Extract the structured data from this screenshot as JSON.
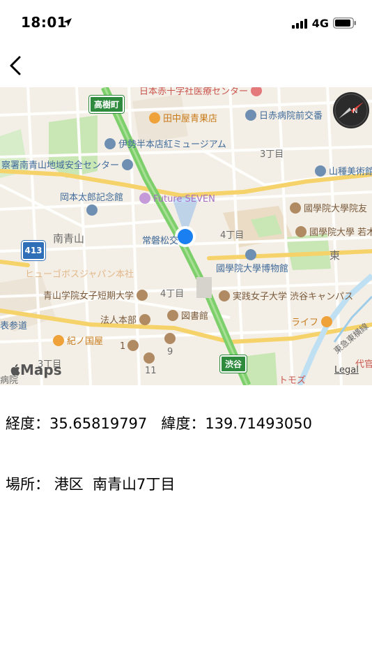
{
  "status_bar": {
    "time": "18:01",
    "network": "4G"
  },
  "nav": {
    "back_icon": "chevron-left-icon"
  },
  "map": {
    "labels": {
      "takagi": "高樹町",
      "red_cross_center": "日本赤十字社医療センター",
      "tanakaya": "田中屋青果店",
      "red_cross_hospital": "日赤病院前交番",
      "isehan": "伊勢半本店紅ミュージアム",
      "chome3": "3丁目",
      "police": "察署南青山地域安全センター",
      "yamatane": "山種美術館",
      "okamoto": "岡本太郎記念館",
      "future_seven": "Future SEVEN",
      "kokugakuin_tomo": "國學院大學院友",
      "minami_aoyama": "南青山",
      "tokiwamatsu": "常磐松交",
      "chome4a": "4丁目",
      "kokugakuin_waka": "國學院大學 若木",
      "route413": "413",
      "higashi": "東",
      "hugo": "ヒューゴボスジャパン本社",
      "kokugakuin_museum": "國學院大學博物館",
      "aoyama_women": "青山学院女子短期大学",
      "chome4b": "4丁目",
      "jissen": "実践女子大学 渋谷キャンパス",
      "houjin": "法人本部",
      "library": "図書館",
      "life": "ライフ",
      "omotesando": "表参道",
      "kinokuniya": "紀ノ国屋",
      "tokyu": "東急東横線",
      "num1": "1",
      "num9": "9",
      "shibuya": "渋谷",
      "chome3b": "3丁目",
      "num11": "11",
      "hospital": "病院",
      "tomoz": "トモズ",
      "daikan": "代官",
      "maps_logo": "Maps",
      "legal": "Legal"
    }
  },
  "info": {
    "longitude_label": "経度：",
    "longitude_value": "35.65819797",
    "latitude_label": "緯度：",
    "latitude_value": "139.71493050",
    "place_label": "場所：",
    "ward": "港区",
    "district": "南青山7丁目"
  },
  "colors": {
    "accent": "#1a7ff0",
    "road": "#7ccf6a",
    "park": "#c9e6b5"
  }
}
